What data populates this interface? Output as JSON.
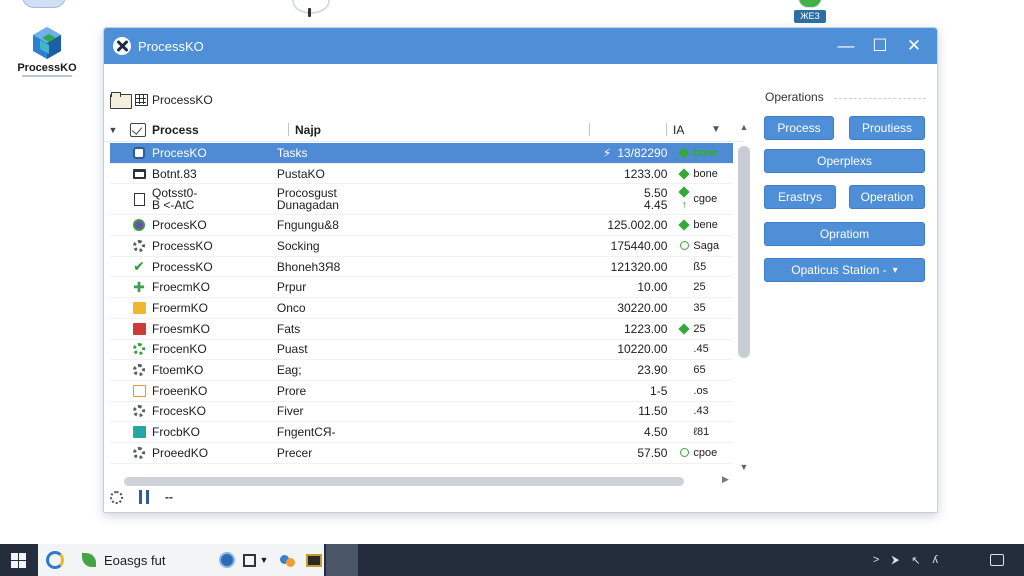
{
  "desktop": {
    "icon_label": "ProcessKO",
    "top_right_label": "ЖЕЗ"
  },
  "window": {
    "title": "ProcessKO",
    "controls": {
      "minimize": "—",
      "maximize": "☐",
      "close": "✕"
    },
    "path": "ProcessKO"
  },
  "list": {
    "headers": {
      "process": "Process",
      "name": "Najp",
      "ia": "IA"
    },
    "rows": [
      {
        "icon": "shield-icon",
        "proc": "ProcesKO",
        "name": "Tasks",
        "val_prefix": "⚡",
        "val": "13/82290",
        "status": "dot",
        "status_text": "bone",
        "selected": true
      },
      {
        "icon": "briefcase-icon",
        "proc": "Botnt.83",
        "name": "PustaKO",
        "val": "1233.00",
        "status": "dot",
        "status_text": "bone"
      },
      {
        "icon": "document-icon",
        "proc": "Qotsst0-\nB <-AtC",
        "name": "Procosgust\nDunagadan",
        "val": "5.50\n4.45",
        "status": "dot-arrow",
        "status_text": "cgoe",
        "tall": true
      },
      {
        "icon": "puzzle-icon",
        "proc": "ProcesKO",
        "name": "Fngungu&8",
        "val": "125.002.00",
        "status": "dot",
        "status_text": "bene"
      },
      {
        "icon": "gear-icon",
        "proc": "ProcessKO",
        "name": "Socking",
        "val": "175440.00",
        "status": "ring",
        "status_text": "Saga"
      },
      {
        "icon": "check-icon",
        "proc": "ProcessKO",
        "name": "Bhoneh3Я8",
        "val": "121320.00",
        "status": "",
        "status_text": "ß5"
      },
      {
        "icon": "plus-icon",
        "proc": "FroeсmKO",
        "name": "Prpur",
        "val": "10.00",
        "status": "",
        "status_text": "25"
      },
      {
        "icon": "yellow-square-icon",
        "proc": "FroermKO",
        "name": "Onco",
        "val": "30220.00",
        "status": "",
        "status_text": "35"
      },
      {
        "icon": "red-square-icon",
        "proc": "FroesmKO",
        "name": "Fats",
        "val": "1223.00",
        "status": "dot",
        "status_text": "25"
      },
      {
        "icon": "green-gear-icon",
        "proc": "FrocenKO",
        "name": "Puast",
        "val": "10220.00",
        "status": "",
        "status_text": ".45"
      },
      {
        "icon": "gear-icon",
        "proc": "FtoemKO",
        "name": "Eag;",
        "val": "23.90",
        "status": "",
        "status_text": "65"
      },
      {
        "icon": "orange-square-icon",
        "proc": "FroeenKO",
        "name": "Prore",
        "val": "1-5",
        "status": "",
        "status_text": ".os"
      },
      {
        "icon": "gear-icon",
        "proc": "FrocesKO",
        "name": "Fiver",
        "val": "11.50",
        "status": "",
        "status_text": ".43"
      },
      {
        "icon": "teal-grid-icon",
        "proc": "FrocbKO",
        "name": "FngentСЯ-",
        "val": "4.50",
        "status": "",
        "status_text": "ℓ81"
      },
      {
        "icon": "gear-icon",
        "proc": "ProeedKO",
        "name": "Precer",
        "val": "57.50",
        "status": "ring",
        "status_text": "cpoe"
      }
    ]
  },
  "operations": {
    "title": "Operations",
    "buttons": {
      "process": "Process",
      "proutiess": "Proutiess",
      "operplexs": "Operplexs",
      "erastrys": "Erastrys",
      "operation": "Operation",
      "opratiom": "Opratiom",
      "station": "Opaticus Station -"
    }
  },
  "taskbar": {
    "search_text": "Eoasgs fut",
    "tray": {
      "a": "˃",
      "b": "⮞",
      "c": "↖",
      "d": "ʎ"
    }
  },
  "colors": {
    "accent": "#4f8fd8",
    "selection": "#4e8bd4",
    "status_green": "#36a83a",
    "taskbar": "#232d3b"
  }
}
